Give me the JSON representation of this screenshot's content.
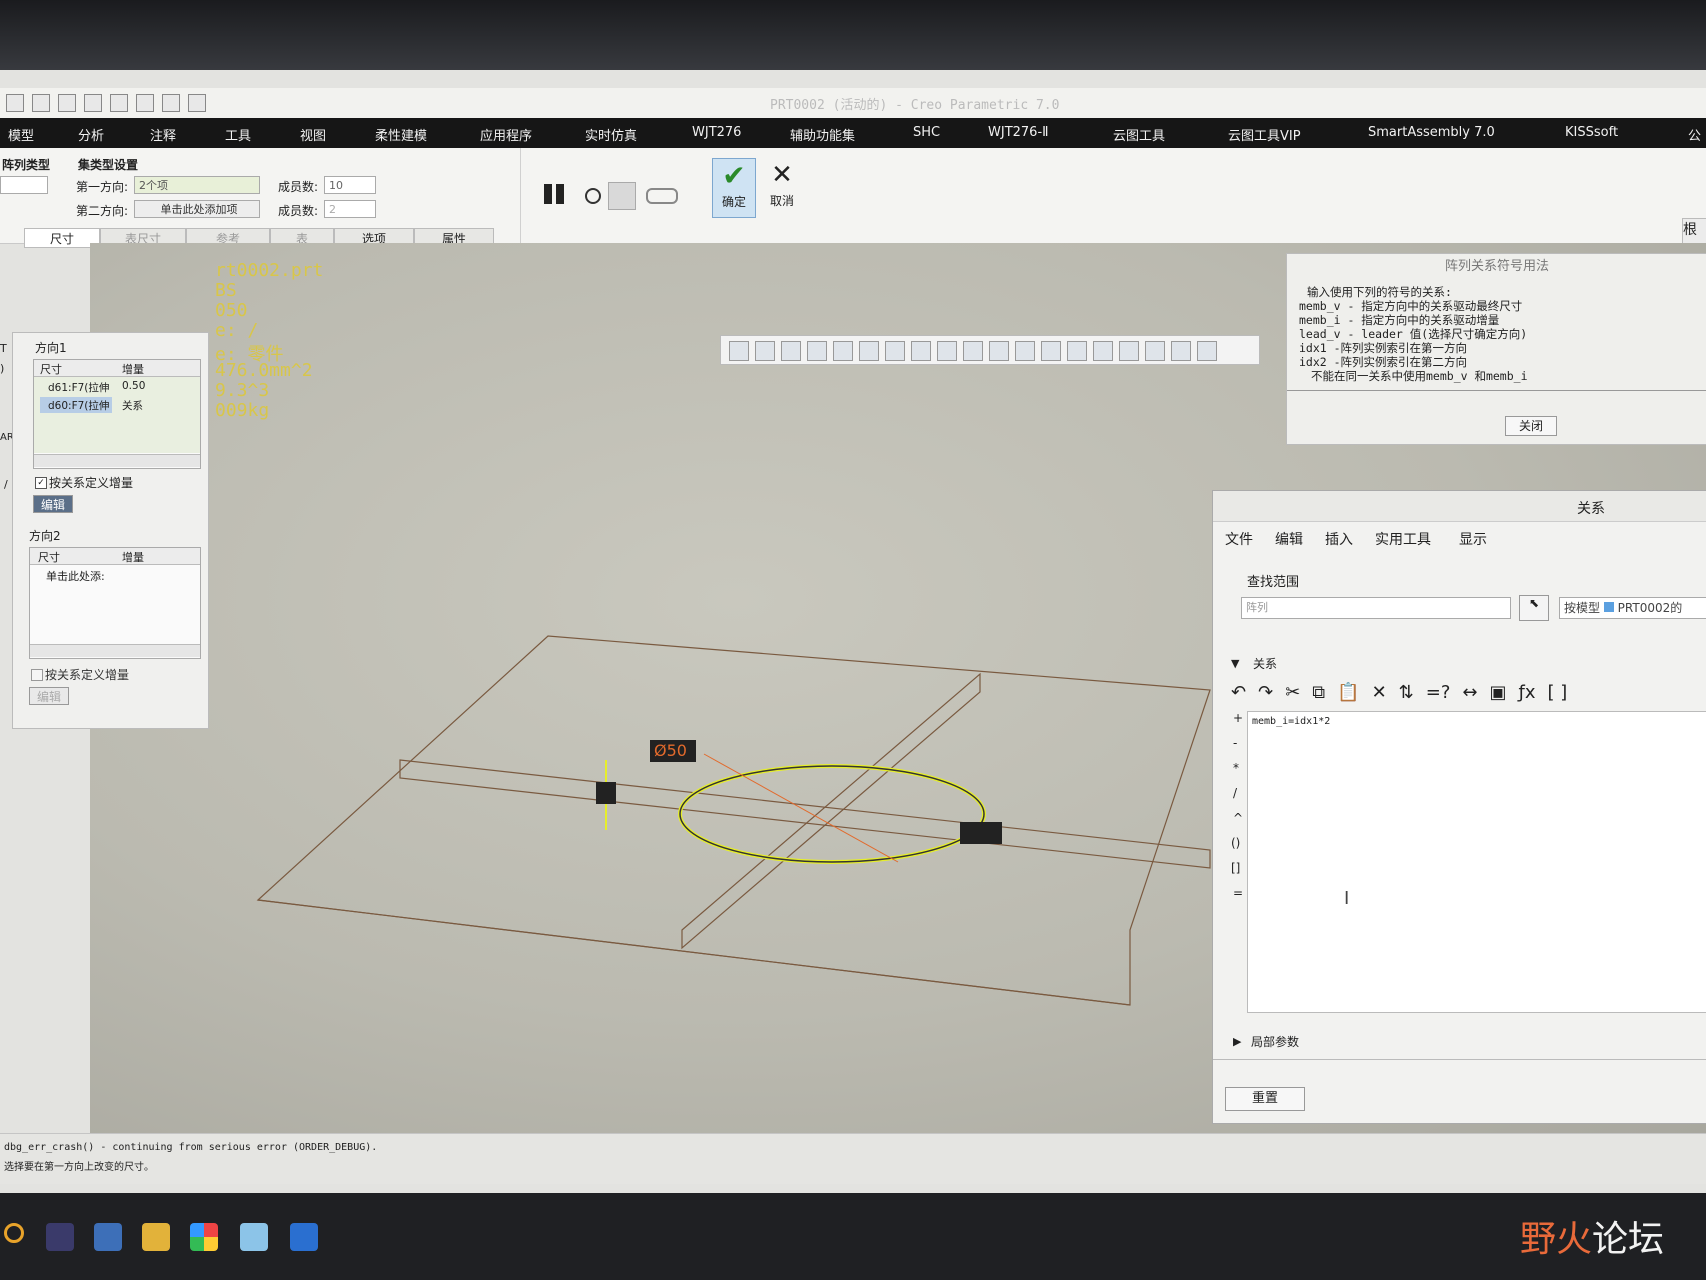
{
  "window_title": "PRT0002 (活动的) - Creo Parametric 7.0",
  "menubar": [
    "模型",
    "分析",
    "注释",
    "工具",
    "视图",
    "柔性建模",
    "应用程序",
    "实时仿真",
    "WJT276",
    "辅助功能集",
    "SHC",
    "WJT276-Ⅱ",
    "云图工具",
    "云图工具VIP",
    "SmartAssembly 7.0",
    "KISSsoft",
    "公"
  ],
  "ribbon": {
    "pattern_type_label": "阵列类型",
    "set_type_label": "集类型设置",
    "dir1_label": "第一方向:",
    "dir1_value": "2个项",
    "dir2_label": "第二方向:",
    "dir2_value": "单击此处添加项",
    "members1_label": "成员数:",
    "members1_value": "10",
    "members2_label": "成员数:",
    "members2_value": "2",
    "ok_label": "确定",
    "cancel_label": "取消",
    "right_edge_label": "根"
  },
  "tabs": [
    "尺寸",
    "表尺寸",
    "参考",
    "表",
    "选项",
    "属性"
  ],
  "dim_panel": {
    "dir1_title": "方向1",
    "col_dim": "尺寸",
    "col_inc": "增量",
    "rows": [
      {
        "dim": "d61:F7(拉伸",
        "inc": "0.50"
      },
      {
        "dim": "d60:F7(拉伸",
        "inc": "关系"
      }
    ],
    "checkbox1": "按关系定义增量",
    "edit1": "编辑",
    "dir2_title": "方向2",
    "dir2_col_dim": "尺寸",
    "dir2_col_inc": "增量",
    "dir2_placeholder": "单击此处添:",
    "checkbox2": "按关系定义增量",
    "edit2": "编辑"
  },
  "model_info": [
    "rt0002.prt",
    "BS",
    "050",
    "e: /",
    "e: 零件",
    "476.0mm^2",
    "9.3^3",
    "009kg"
  ],
  "left_edge_labels": [
    "T",
    ")",
    "ART",
    "/"
  ],
  "dimension_tag": "Ø50",
  "help_panel": {
    "title": "阵列关系符号用法",
    "lines": [
      "输入使用下列的符号的关系:",
      "memb_v - 指定方向中的关系驱动最终尺寸",
      "memb_i - 指定方向中的关系驱动增量",
      "lead_v - leader 值(选择尺寸确定方向)",
      "idx1   -阵列实例索引在第一方向",
      "idx2   -阵列实例索引在第二方向",
      "不能在同一关系中使用memb_v 和memb_i"
    ],
    "close": "关闭"
  },
  "relations_dialog": {
    "title": "关系",
    "menu": [
      "文件",
      "编辑",
      "插入",
      "实用工具",
      "显示"
    ],
    "scope_label": "查找范围",
    "scope_value": "阵列",
    "by_model": "按模型",
    "model_name": "PRT0002的",
    "section_label": "关系",
    "editor_text": "memb_i=idx1*2",
    "side_ops": [
      "+",
      "-",
      "*",
      "/",
      "^",
      "()",
      "[]",
      "="
    ],
    "local_params": "局部参数",
    "reset": "重置"
  },
  "status_lines": [
    "dbg_err_crash() - continuing from serious error (ORDER_DEBUG).",
    "选择要在第一方向上改变的尺寸。"
  ],
  "watermark": {
    "part1": "野",
    "part2": "火",
    "part3": "论坛"
  }
}
